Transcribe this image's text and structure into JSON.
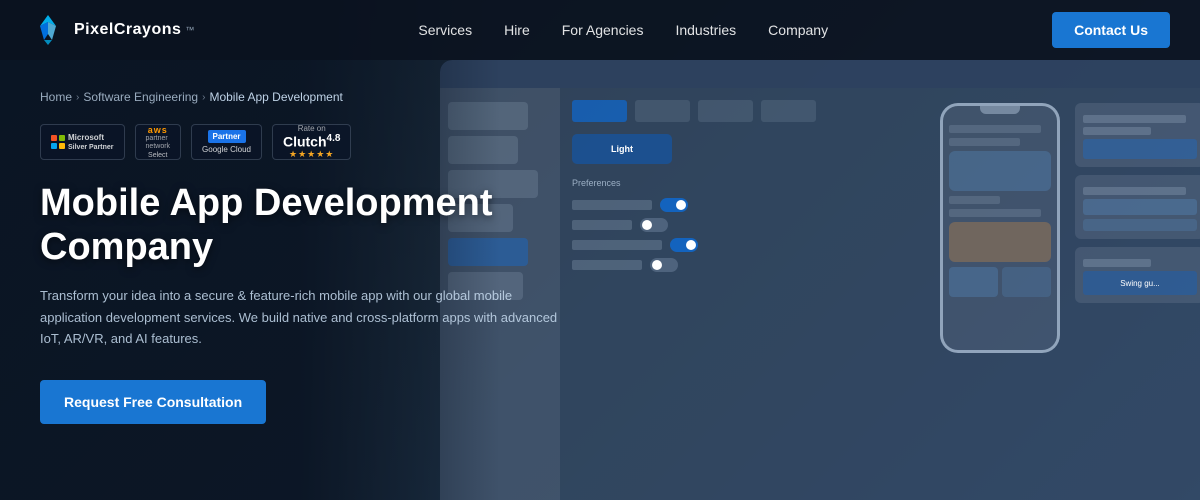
{
  "brand": {
    "name": "PixelCrayons",
    "tm": "™"
  },
  "nav": {
    "links": [
      {
        "label": "Services",
        "id": "services"
      },
      {
        "label": "Hire",
        "id": "hire"
      },
      {
        "label": "For Agencies",
        "id": "for-agencies"
      },
      {
        "label": "Industries",
        "id": "industries"
      },
      {
        "label": "Company",
        "id": "company"
      }
    ],
    "contact_btn": "Contact Us"
  },
  "breadcrumb": {
    "items": [
      {
        "label": "Home",
        "id": "home"
      },
      {
        "label": "Software Engineering",
        "id": "software-engineering"
      },
      {
        "label": "Mobile App Development",
        "id": "mobile-app-development"
      }
    ]
  },
  "partners": [
    {
      "id": "microsoft",
      "label": "Microsoft Silver Partner"
    },
    {
      "id": "aws",
      "label": "AWS Partner Network Select"
    },
    {
      "id": "google",
      "label": "Google Cloud Partner"
    },
    {
      "id": "clutch",
      "label": "Rated on Clutch 4.8",
      "rating": "4.8",
      "stars": "★★★★★"
    }
  ],
  "hero": {
    "heading": "Mobile App Development Company",
    "description": "Transform your idea into a secure & feature-rich mobile app with our global mobile application development services. We build native and cross-platform apps with advanced IoT, AR/VR, and AI features.",
    "cta": "Request Free Consultation"
  },
  "colors": {
    "primary_btn": "#1976d2",
    "accent": "#1976d2",
    "stars": "#f5a623"
  }
}
